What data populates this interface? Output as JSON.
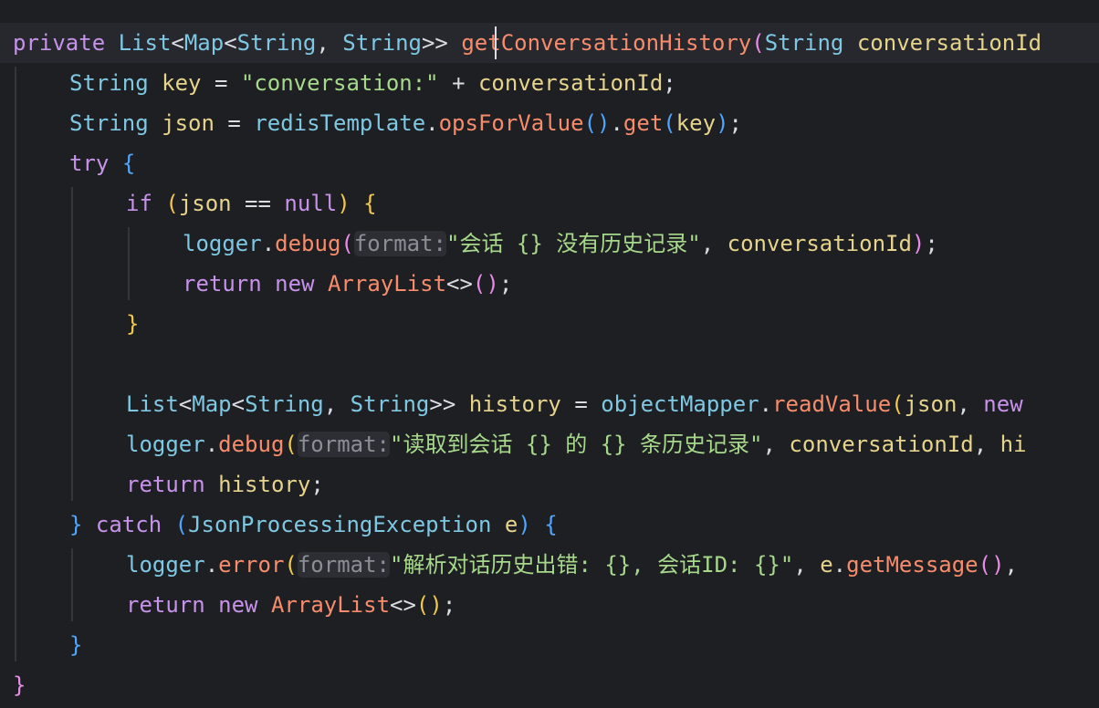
{
  "code_lines": [
    [
      {
        "t": "private",
        "c": "kw"
      },
      {
        "t": " ",
        "c": "pl"
      },
      {
        "t": "List",
        "c": "ty"
      },
      {
        "t": "<",
        "c": "pl"
      },
      {
        "t": "Map",
        "c": "ty"
      },
      {
        "t": "<",
        "c": "pl"
      },
      {
        "t": "String",
        "c": "ty"
      },
      {
        "t": ", ",
        "c": "pl"
      },
      {
        "t": "String",
        "c": "ty"
      },
      {
        "t": ">> ",
        "c": "pl"
      },
      {
        "t": "getConversationHistory",
        "c": "fn"
      },
      {
        "t": "(",
        "c": "b2"
      },
      {
        "t": "String",
        "c": "ty"
      },
      {
        "t": " ",
        "c": "pl"
      },
      {
        "t": "conversationId",
        "c": "var"
      }
    ],
    [
      {
        "t": "String",
        "c": "ty"
      },
      {
        "t": " ",
        "c": "pl"
      },
      {
        "t": "key",
        "c": "var"
      },
      {
        "t": " = ",
        "c": "pl"
      },
      {
        "t": "\"conversation:\"",
        "c": "str"
      },
      {
        "t": " + ",
        "c": "pl"
      },
      {
        "t": "conversationId",
        "c": "var"
      },
      {
        "t": ";",
        "c": "pl"
      }
    ],
    [
      {
        "t": "String",
        "c": "ty"
      },
      {
        "t": " ",
        "c": "pl"
      },
      {
        "t": "json",
        "c": "var"
      },
      {
        "t": " = ",
        "c": "pl"
      },
      {
        "t": "redisTemplate",
        "c": "ty"
      },
      {
        "t": ".",
        "c": "pl"
      },
      {
        "t": "opsForValue",
        "c": "fn"
      },
      {
        "t": "()",
        "c": "b3"
      },
      {
        "t": ".",
        "c": "pl"
      },
      {
        "t": "get",
        "c": "fn"
      },
      {
        "t": "(",
        "c": "b3"
      },
      {
        "t": "key",
        "c": "var"
      },
      {
        "t": ")",
        "c": "b3"
      },
      {
        "t": ";",
        "c": "pl"
      }
    ],
    [
      {
        "t": "try",
        "c": "kw"
      },
      {
        "t": " ",
        "c": "pl"
      },
      {
        "t": "{",
        "c": "b3"
      }
    ],
    [
      {
        "t": "if",
        "c": "kw"
      },
      {
        "t": " ",
        "c": "pl"
      },
      {
        "t": "(",
        "c": "b1"
      },
      {
        "t": "json",
        "c": "var"
      },
      {
        "t": " == ",
        "c": "pl"
      },
      {
        "t": "null",
        "c": "kw"
      },
      {
        "t": ")",
        "c": "b1"
      },
      {
        "t": " ",
        "c": "pl"
      },
      {
        "t": "{",
        "c": "b1"
      }
    ],
    [
      {
        "t": "logger",
        "c": "ty"
      },
      {
        "t": ".",
        "c": "pl"
      },
      {
        "t": "debug",
        "c": "fn"
      },
      {
        "t": "(",
        "c": "b2"
      },
      {
        "t": "format:",
        "c": "hint"
      },
      {
        "t": "\"会话 {} 没有历史记录\"",
        "c": "str"
      },
      {
        "t": ", ",
        "c": "pl"
      },
      {
        "t": "conversationId",
        "c": "var"
      },
      {
        "t": ")",
        "c": "b2"
      },
      {
        "t": ";",
        "c": "pl"
      }
    ],
    [
      {
        "t": "return",
        "c": "kw"
      },
      {
        "t": " ",
        "c": "pl"
      },
      {
        "t": "new",
        "c": "kw"
      },
      {
        "t": " ",
        "c": "pl"
      },
      {
        "t": "ArrayList",
        "c": "fn"
      },
      {
        "t": "<>",
        "c": "pl"
      },
      {
        "t": "()",
        "c": "b2"
      },
      {
        "t": ";",
        "c": "pl"
      }
    ],
    [
      {
        "t": "}",
        "c": "b1"
      }
    ],
    [],
    [
      {
        "t": "List",
        "c": "ty"
      },
      {
        "t": "<",
        "c": "pl"
      },
      {
        "t": "Map",
        "c": "ty"
      },
      {
        "t": "<",
        "c": "pl"
      },
      {
        "t": "String",
        "c": "ty"
      },
      {
        "t": ", ",
        "c": "pl"
      },
      {
        "t": "String",
        "c": "ty"
      },
      {
        "t": ">> ",
        "c": "pl"
      },
      {
        "t": "history",
        "c": "var"
      },
      {
        "t": " = ",
        "c": "pl"
      },
      {
        "t": "objectMapper",
        "c": "ty"
      },
      {
        "t": ".",
        "c": "pl"
      },
      {
        "t": "readValue",
        "c": "fn"
      },
      {
        "t": "(",
        "c": "b1"
      },
      {
        "t": "json",
        "c": "var"
      },
      {
        "t": ", ",
        "c": "pl"
      },
      {
        "t": "new",
        "c": "kw"
      }
    ],
    [
      {
        "t": "logger",
        "c": "ty"
      },
      {
        "t": ".",
        "c": "pl"
      },
      {
        "t": "debug",
        "c": "fn"
      },
      {
        "t": "(",
        "c": "b1"
      },
      {
        "t": "format:",
        "c": "hint"
      },
      {
        "t": "\"读取到会话 {} 的 {} 条历史记录\"",
        "c": "str"
      },
      {
        "t": ", ",
        "c": "pl"
      },
      {
        "t": "conversationId",
        "c": "var"
      },
      {
        "t": ", ",
        "c": "pl"
      },
      {
        "t": "hi",
        "c": "var"
      }
    ],
    [
      {
        "t": "return",
        "c": "kw"
      },
      {
        "t": " ",
        "c": "pl"
      },
      {
        "t": "history",
        "c": "var"
      },
      {
        "t": ";",
        "c": "pl"
      }
    ],
    [
      {
        "t": "}",
        "c": "b3"
      },
      {
        "t": " ",
        "c": "pl"
      },
      {
        "t": "catch",
        "c": "kw"
      },
      {
        "t": " ",
        "c": "pl"
      },
      {
        "t": "(",
        "c": "b3"
      },
      {
        "t": "JsonProcessingException",
        "c": "ty"
      },
      {
        "t": " ",
        "c": "pl"
      },
      {
        "t": "e",
        "c": "var"
      },
      {
        "t": ")",
        "c": "b3"
      },
      {
        "t": " ",
        "c": "pl"
      },
      {
        "t": "{",
        "c": "b3"
      }
    ],
    [
      {
        "t": "logger",
        "c": "ty"
      },
      {
        "t": ".",
        "c": "pl"
      },
      {
        "t": "error",
        "c": "fn"
      },
      {
        "t": "(",
        "c": "b1"
      },
      {
        "t": "format:",
        "c": "hint"
      },
      {
        "t": "\"解析对话历史出错: {}, 会话ID: {}\"",
        "c": "str"
      },
      {
        "t": ", ",
        "c": "pl"
      },
      {
        "t": "e",
        "c": "var"
      },
      {
        "t": ".",
        "c": "pl"
      },
      {
        "t": "getMessage",
        "c": "fn"
      },
      {
        "t": "()",
        "c": "b2"
      },
      {
        "t": ",",
        "c": "pl"
      }
    ],
    [
      {
        "t": "return",
        "c": "kw"
      },
      {
        "t": " ",
        "c": "pl"
      },
      {
        "t": "new",
        "c": "kw"
      },
      {
        "t": " ",
        "c": "pl"
      },
      {
        "t": "ArrayList",
        "c": "fn"
      },
      {
        "t": "<>",
        "c": "pl"
      },
      {
        "t": "()",
        "c": "b1"
      },
      {
        "t": ";",
        "c": "pl"
      }
    ],
    [
      {
        "t": "}",
        "c": "b3"
      }
    ],
    [
      {
        "t": "}",
        "c": "b2"
      }
    ]
  ]
}
